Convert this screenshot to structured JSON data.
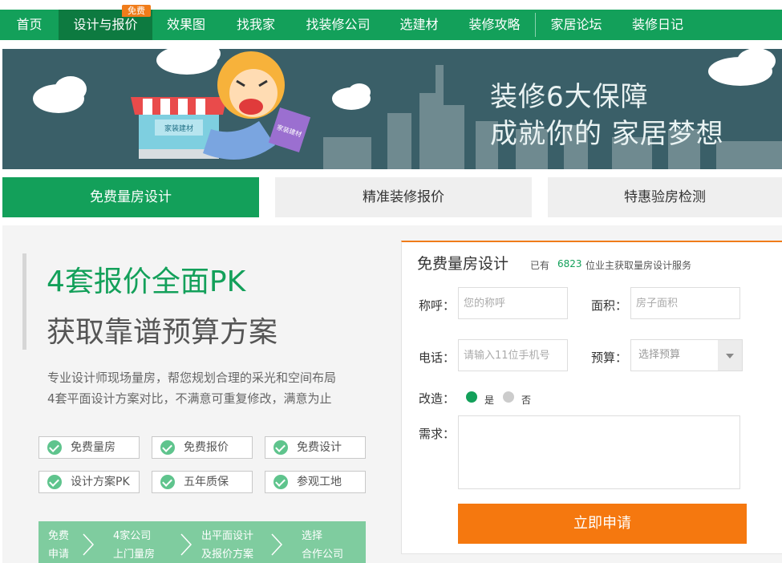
{
  "nav": {
    "items": [
      "首页",
      "设计与报价",
      "效果图",
      "找我家",
      "找装修公司",
      "选建材",
      "装修攻略",
      "家居论坛",
      "装修日记"
    ],
    "active_index": 1,
    "badge": "免费"
  },
  "banner": {
    "slogan_line1": "装修6大保障",
    "slogan_line2": "成就你的 家居梦想",
    "shop_sign": "家装建材",
    "bag_text": "家装建材"
  },
  "tabs": [
    "免费量房设计",
    "精准装修报价",
    "特惠验房检测"
  ],
  "hero": {
    "headline": "4套报价全面PK",
    "subheadline": "获取靠谱预算方案",
    "desc_line1": "专业设计师现场量房，帮您规划合理的采光和空间布局",
    "desc_line2": "4套平面设计方案对比，不满意可重复修改，满意为止"
  },
  "features": [
    "免费量房",
    "免费报价",
    "免费设计",
    "设计方案PK",
    "五年质保",
    "参观工地"
  ],
  "steps": [
    {
      "line1": "免费",
      "line2": "申请"
    },
    {
      "line1": "4家公司",
      "line2": "上门量房"
    },
    {
      "line1": "出平面设计",
      "line2": "及报价方案"
    },
    {
      "line1": "选择",
      "line2": "合作公司"
    }
  ],
  "form": {
    "title": "免费量房设计",
    "count_prefix": "已有",
    "count": "6823",
    "count_suffix": "位业主获取量房设计服务",
    "name_label": "称呼：",
    "name_placeholder": "您的称呼",
    "area_label": "面积：",
    "area_placeholder": "房子面积",
    "phone_label": "电话：",
    "phone_placeholder": "请输入11位手机号",
    "budget_label": "预算：",
    "budget_placeholder": "选择预算",
    "renovate_label": "改造：",
    "yes": "是",
    "no": "否",
    "renovate_selected": "是",
    "needs_label": "需求：",
    "submit": "立即申请"
  },
  "colors": {
    "green": "#13a05a",
    "dark_green": "#0d7a40",
    "orange": "#f5780f",
    "banner_bg": "#3a5f68"
  }
}
